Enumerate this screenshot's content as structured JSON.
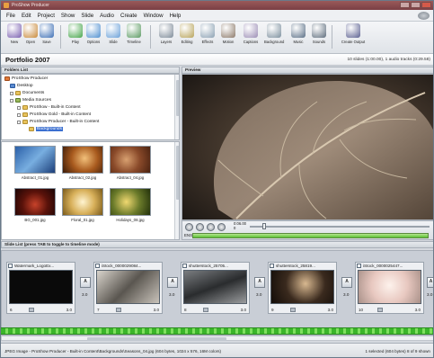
{
  "window": {
    "title": "ProShow Producer"
  },
  "menu": [
    "File",
    "Edit",
    "Project",
    "Show",
    "Slide",
    "Audio",
    "Create",
    "Window",
    "Help"
  ],
  "toolbar": {
    "buttons": [
      {
        "label": "New",
        "icon": "new-icon",
        "color": "#7a5fb0"
      },
      {
        "label": "Open",
        "icon": "open-icon",
        "color": "#c98a3a"
      },
      {
        "label": "Save",
        "icon": "save-icon",
        "color": "#3d6fb5"
      },
      {
        "label": "Play",
        "icon": "play-icon",
        "color": "#46a54a"
      },
      {
        "label": "Options",
        "icon": "options-icon",
        "color": "#4f8fd0"
      },
      {
        "label": "Slide",
        "icon": "slide-icon",
        "color": "#6aa0d8"
      },
      {
        "label": "Timeline",
        "icon": "timeline-icon",
        "color": "#5b9a62"
      },
      {
        "label": "Layers",
        "icon": "layers-icon",
        "color": "#7d8a98"
      },
      {
        "label": "Editing",
        "icon": "editing-icon",
        "color": "#b7a35a"
      },
      {
        "label": "Effects",
        "icon": "effects-icon",
        "color": "#8aa0b2"
      },
      {
        "label": "Motion",
        "icon": "motion-icon",
        "color": "#8c7a6a"
      },
      {
        "label": "Captions",
        "icon": "captions-icon",
        "color": "#9b8db5"
      },
      {
        "label": "Background",
        "icon": "background-icon",
        "color": "#7c8f9e"
      },
      {
        "label": "Music",
        "icon": "music-icon",
        "color": "#5a6f86"
      },
      {
        "label": "Sounds",
        "icon": "sounds-icon",
        "color": "#5d6c7c"
      },
      {
        "label": "Create Output",
        "icon": "create-output-icon",
        "color": "#5a5f90"
      }
    ]
  },
  "project": {
    "title": "Portfolio 2007",
    "info": "10 slides (1:00.00), 1 audio tracks (0:29.58)"
  },
  "folders": {
    "header": "Folders List",
    "tree": [
      {
        "label": "ProShow Producer",
        "level": 0,
        "selected": false
      },
      {
        "label": "Desktop",
        "level": 1,
        "selected": false
      },
      {
        "label": "Documents",
        "level": 1,
        "selected": false
      },
      {
        "label": "Media Sources",
        "level": 1,
        "selected": false
      },
      {
        "label": "ProShow - Built-in Content",
        "level": 2,
        "selected": false
      },
      {
        "label": "ProShow Gold - Built-in Content",
        "level": 2,
        "selected": false
      },
      {
        "label": "ProShow Producer - Built-in Content",
        "level": 2,
        "selected": false
      },
      {
        "label": "Backgrounds",
        "level": 3,
        "selected": true
      }
    ]
  },
  "files": [
    {
      "name": "Abstract_01.jpg",
      "bg": "linear-gradient(135deg,#2a5fa8,#78aee0,#1d3f7a)"
    },
    {
      "name": "Abstract_02.jpg",
      "bg": "radial-gradient(circle at 55% 45%,#f2c07a,#a85a1e,#3a1a08)"
    },
    {
      "name": "Abstract_04.jpg",
      "bg": "radial-gradient(circle at 40% 50%,#d8a070,#8a4a2a,#4a2210)"
    },
    {
      "name": "BG_001.jpg",
      "bg": "radial-gradient(circle at 50% 60%,#c7422a,#5a120a,#1a0505)"
    },
    {
      "name": "Floral_01.jpg",
      "bg": "radial-gradient(circle at 50% 50%,#fff4d0,#d8b05a,#7a5a1a)"
    },
    {
      "name": "Holidays_08.jpg",
      "bg": "radial-gradient(circle at 40% 50%,#f0d870,#6a7a2a,#22300a)"
    }
  ],
  "preview": {
    "header": "Preview"
  },
  "playback": {
    "time_top": "0:06.00",
    "time_bottom": "0",
    "audio_label": "ENS"
  },
  "slidelist": {
    "header": "Slide List (press TAB to toggle to timeline mode)",
    "slides": [
      {
        "name": "Watermark_LogoEx...",
        "number": "6",
        "duration": "3.0",
        "bg": "#0a0a0a"
      },
      {
        "name": "iStock_0000029084...",
        "number": "7",
        "duration": "3.0",
        "bg": "linear-gradient(135deg,#d9d4cc,#5a5650,#c9c3ba)"
      },
      {
        "name": "shutterstock_25705...",
        "number": "8",
        "duration": "3.0",
        "bg": "linear-gradient(160deg,#7a7d80,#2a2c2e,#9a9c9e)"
      },
      {
        "name": "shutterstock_25819...",
        "number": "9",
        "duration": "3.0",
        "bg": "radial-gradient(circle at 55% 40%,#d8b890,#3a2a1e,#120c08)"
      },
      {
        "name": "iStock_0000025447...",
        "number": "10",
        "duration": "3.0",
        "bg": "radial-gradient(circle at 50% 45%,#fdf2ec,#e8c8c0,#a89088)"
      }
    ],
    "transitions": [
      {
        "label": "A",
        "duration": "3.0"
      },
      {
        "label": "A",
        "duration": "3.0"
      },
      {
        "label": "A",
        "duration": "3.0"
      },
      {
        "label": "A",
        "duration": "3.0"
      },
      {
        "label": "A",
        "duration": "3.0"
      }
    ]
  },
  "status": {
    "left": "JPEG Image - ProShow Producer - Built-in Content\\Backgrounds\\Seasons_04.jpg (604 bytes, 1024 x 576, 16M colors)",
    "right": "1 selected (604 bytes) 8 of 9 shown"
  }
}
